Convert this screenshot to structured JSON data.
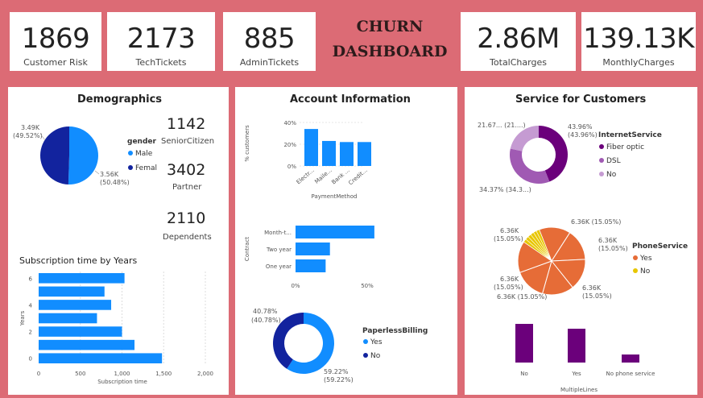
{
  "kpis": [
    {
      "value": "1869",
      "label": "Customer Risk"
    },
    {
      "value": "2173",
      "label": "TechTickets"
    },
    {
      "value": "885",
      "label": "AdminTickets"
    },
    {
      "value": "2.86M",
      "label": "TotalCharges"
    },
    {
      "value": "139.13K",
      "label": "MonthlyCharges"
    }
  ],
  "dashboard_title_line1": "CHURN",
  "dashboard_title_line2": "DASHBOARD",
  "panels": {
    "demographics": "Demographics",
    "account": "Account Information",
    "service": "Service for Customers"
  },
  "stats": [
    {
      "value": "1142",
      "label": "SeniorCitizen"
    },
    {
      "value": "3402",
      "label": "Partner"
    },
    {
      "value": "2110",
      "label": "Dependents"
    }
  ],
  "colors": {
    "blue": "#118dff",
    "navy": "#12239e",
    "purple": "#6b007b",
    "purple_mid": "#a05ab3",
    "purple_light": "#c59bd2",
    "orange": "#e66c37",
    "yellow": "#e8c600",
    "background": "#dc6b75"
  },
  "chart_data": [
    {
      "id": "gender",
      "type": "pie",
      "legend_title": "gender",
      "slices": [
        {
          "name": "Male",
          "value": 3.56,
          "label": "3.56K",
          "pct": "(50.48%)",
          "color": "#118dff"
        },
        {
          "name": "Femal",
          "value": 3.49,
          "label": "3.49K",
          "pct": "(49.52%)",
          "color": "#12239e"
        }
      ]
    },
    {
      "id": "subscription",
      "type": "bar",
      "orientation": "horizontal",
      "title": "Subscription time by Years",
      "xlabel": "Subscription time",
      "ylabel": "Years",
      "categories": [
        0,
        1,
        2,
        3,
        4,
        5,
        6
      ],
      "values": [
        1480,
        1150,
        1000,
        700,
        870,
        790,
        1030
      ],
      "xlim": [
        0,
        2000
      ],
      "xticks": [
        "0",
        "500",
        "1,000",
        "1,500",
        "2,000"
      ],
      "yticks": [
        "0",
        "2",
        "4",
        "6"
      ]
    },
    {
      "id": "payment",
      "type": "bar",
      "xlabel": "PaymentMethod",
      "ylabel": "% customers",
      "categories": [
        "Electr...",
        "Maile...",
        "Bank ...",
        "Credit..."
      ],
      "values": [
        34,
        23,
        22,
        22
      ],
      "ylim": [
        0,
        40
      ],
      "yticks": [
        "0%",
        "20%",
        "40%"
      ]
    },
    {
      "id": "contract",
      "type": "bar",
      "orientation": "horizontal",
      "ylabel": "Contract",
      "categories": [
        "Month-t...",
        "Two year",
        "One year"
      ],
      "values": [
        55,
        24,
        21
      ],
      "xlim": [
        0,
        50
      ],
      "xticks": [
        "0%",
        "50%"
      ]
    },
    {
      "id": "paperless",
      "type": "pie",
      "donut": true,
      "legend_title": "PaperlessBilling",
      "slices": [
        {
          "name": "Yes",
          "value": 59.22,
          "label": "59.22%",
          "pct": "(59.22%)",
          "color": "#118dff"
        },
        {
          "name": "No",
          "value": 40.78,
          "label": "40.78%",
          "pct": "(40.78%)",
          "color": "#12239e"
        }
      ]
    },
    {
      "id": "internet",
      "type": "pie",
      "donut": true,
      "legend_title": "InternetService",
      "slices": [
        {
          "name": "Fiber optic",
          "value": 43.96,
          "label": "43.96%",
          "pct": "(43.96%)",
          "color": "#6b007b"
        },
        {
          "name": "DSL",
          "value": 34.37,
          "label": "34.37% (34.3...)",
          "pct": "",
          "color": "#a05ab3"
        },
        {
          "name": "No",
          "value": 21.67,
          "label": "21.67... (21....)",
          "pct": "",
          "color": "#c59bd2"
        }
      ]
    },
    {
      "id": "phone",
      "type": "pie",
      "legend_title": "PhoneService",
      "legend": [
        {
          "name": "Yes",
          "color": "#e66c37"
        },
        {
          "name": "No",
          "color": "#e8c600"
        }
      ],
      "slices_yes": [
        15.05,
        15.05,
        15.05,
        15.05,
        15.05,
        15.05
      ],
      "slices_no": [
        1.6,
        1.6,
        1.6,
        1.6,
        1.5,
        1.5
      ],
      "labels": [
        {
          "text": "6.36K (15.05%)",
          "x": 0,
          "y": 0
        },
        {
          "text": "6.36K",
          "x": 0,
          "y": 0
        },
        {
          "text": "(15.05%)",
          "x": 0,
          "y": 0
        }
      ]
    },
    {
      "id": "multiplelines",
      "type": "bar",
      "xlabel": "MultipleLines",
      "categories": [
        "No",
        "Yes",
        "No phone service"
      ],
      "values": [
        48,
        42,
        10
      ],
      "ylim": [
        0,
        50
      ]
    }
  ]
}
